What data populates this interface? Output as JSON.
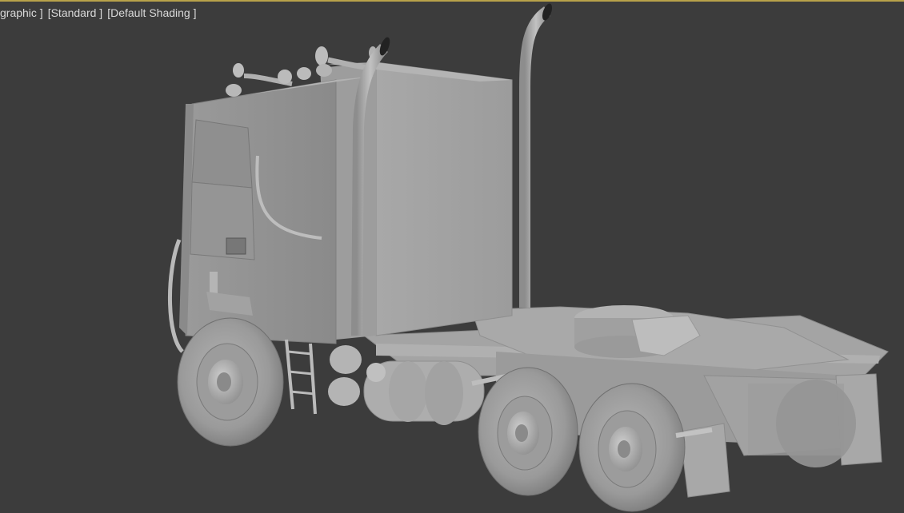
{
  "viewport": {
    "label_view": "graphic ]",
    "label_standard": "[Standard ]",
    "label_shading": "[Default Shading ]",
    "active_border_color": "#b8a24a",
    "background_color": "#3c3c3c"
  },
  "scene": {
    "object": "semi-truck-tractor-model",
    "material_color": "#a9a9a9"
  }
}
